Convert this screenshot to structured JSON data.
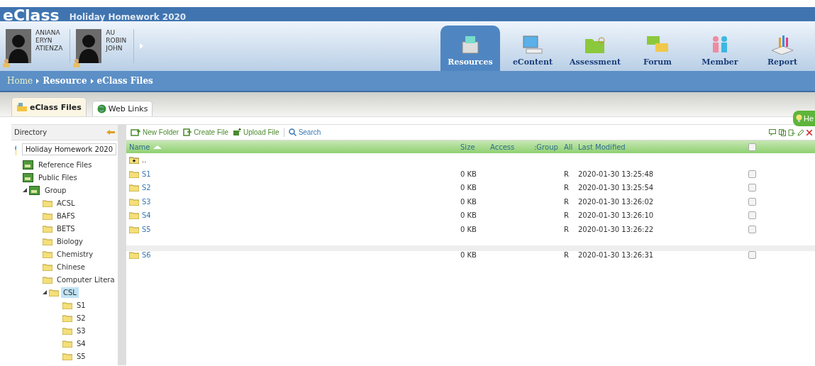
{
  "header": {
    "logo": "eClass",
    "title": "Holiday Homework 2020"
  },
  "users": [
    {
      "lines": [
        "ANIANA",
        "ERYN",
        "ATIENZA"
      ]
    },
    {
      "lines": [
        "AU",
        "ROBIN",
        "JOHN"
      ]
    }
  ],
  "nav": [
    {
      "label": "Resources",
      "selected": true
    },
    {
      "label": "eContent",
      "selected": false
    },
    {
      "label": "Assessment",
      "selected": false
    },
    {
      "label": "Forum",
      "selected": false
    },
    {
      "label": "Member",
      "selected": false
    },
    {
      "label": "Report",
      "selected": false
    }
  ],
  "breadcrumb": [
    "Home",
    "Resource",
    "eClass Files"
  ],
  "tabs": [
    {
      "label": "eClass Files",
      "selected": true
    },
    {
      "label": "Web Links",
      "selected": false
    }
  ],
  "help": "He",
  "directory": {
    "title": "Directory",
    "root": "Holiday Homework 2020",
    "items": [
      {
        "label": "Reference Files",
        "kind": "drive",
        "selected": false
      },
      {
        "label": "Public Files",
        "kind": "drive",
        "selected": false
      },
      {
        "label": "Group",
        "kind": "drive",
        "selected": false,
        "expanded": true,
        "children": [
          {
            "label": "ACSL",
            "kind": "folder",
            "selected": false
          },
          {
            "label": "BAFS",
            "kind": "folder",
            "selected": false
          },
          {
            "label": "BETS",
            "kind": "folder",
            "selected": false
          },
          {
            "label": "Biology",
            "kind": "folder",
            "selected": false
          },
          {
            "label": "Chemistry",
            "kind": "folder",
            "selected": false
          },
          {
            "label": "Chinese",
            "kind": "folder",
            "selected": false
          },
          {
            "label": "Computer Literа",
            "kind": "folder",
            "selected": false
          },
          {
            "label": "CSL",
            "kind": "folder",
            "selected": true,
            "expanded": true,
            "children": [
              {
                "label": "S1",
                "kind": "folder",
                "selected": false
              },
              {
                "label": "S2",
                "kind": "folder",
                "selected": false
              },
              {
                "label": "S3",
                "kind": "folder",
                "selected": false
              },
              {
                "label": "S4",
                "kind": "folder",
                "selected": false
              },
              {
                "label": "S5",
                "kind": "folder",
                "selected": false
              }
            ]
          }
        ]
      }
    ]
  },
  "toolbar": [
    "New Folder",
    "Create File",
    "Upload File",
    "Search"
  ],
  "table": {
    "columns": [
      "Name",
      "Size",
      "Access",
      ":Group",
      "All",
      "Last Modified"
    ],
    "all_checked": false,
    "rows": [
      {
        "kind": "parent",
        "name": ".."
      },
      {
        "kind": "folder",
        "name": "S1",
        "size": "0 KB",
        "access": "R",
        "modified": "2020-01-30 13:25:48",
        "checked": false,
        "gap_before": false
      },
      {
        "kind": "folder",
        "name": "S2",
        "size": "0 KB",
        "access": "R",
        "modified": "2020-01-30 13:25:54",
        "checked": false,
        "gap_before": false
      },
      {
        "kind": "folder",
        "name": "S3",
        "size": "0 KB",
        "access": "R",
        "modified": "2020-01-30 13:26:02",
        "checked": false,
        "gap_before": false
      },
      {
        "kind": "folder",
        "name": "S4",
        "size": "0 KB",
        "access": "R",
        "modified": "2020-01-30 13:26:10",
        "checked": false,
        "gap_before": false
      },
      {
        "kind": "folder",
        "name": "S5",
        "size": "0 KB",
        "access": "R",
        "modified": "2020-01-30 13:26:22",
        "checked": false,
        "gap_before": false
      },
      {
        "kind": "folder",
        "name": "S6",
        "size": "0 KB",
        "access": "R",
        "modified": "2020-01-30 13:26:31",
        "checked": false,
        "gap_before": true
      }
    ]
  }
}
